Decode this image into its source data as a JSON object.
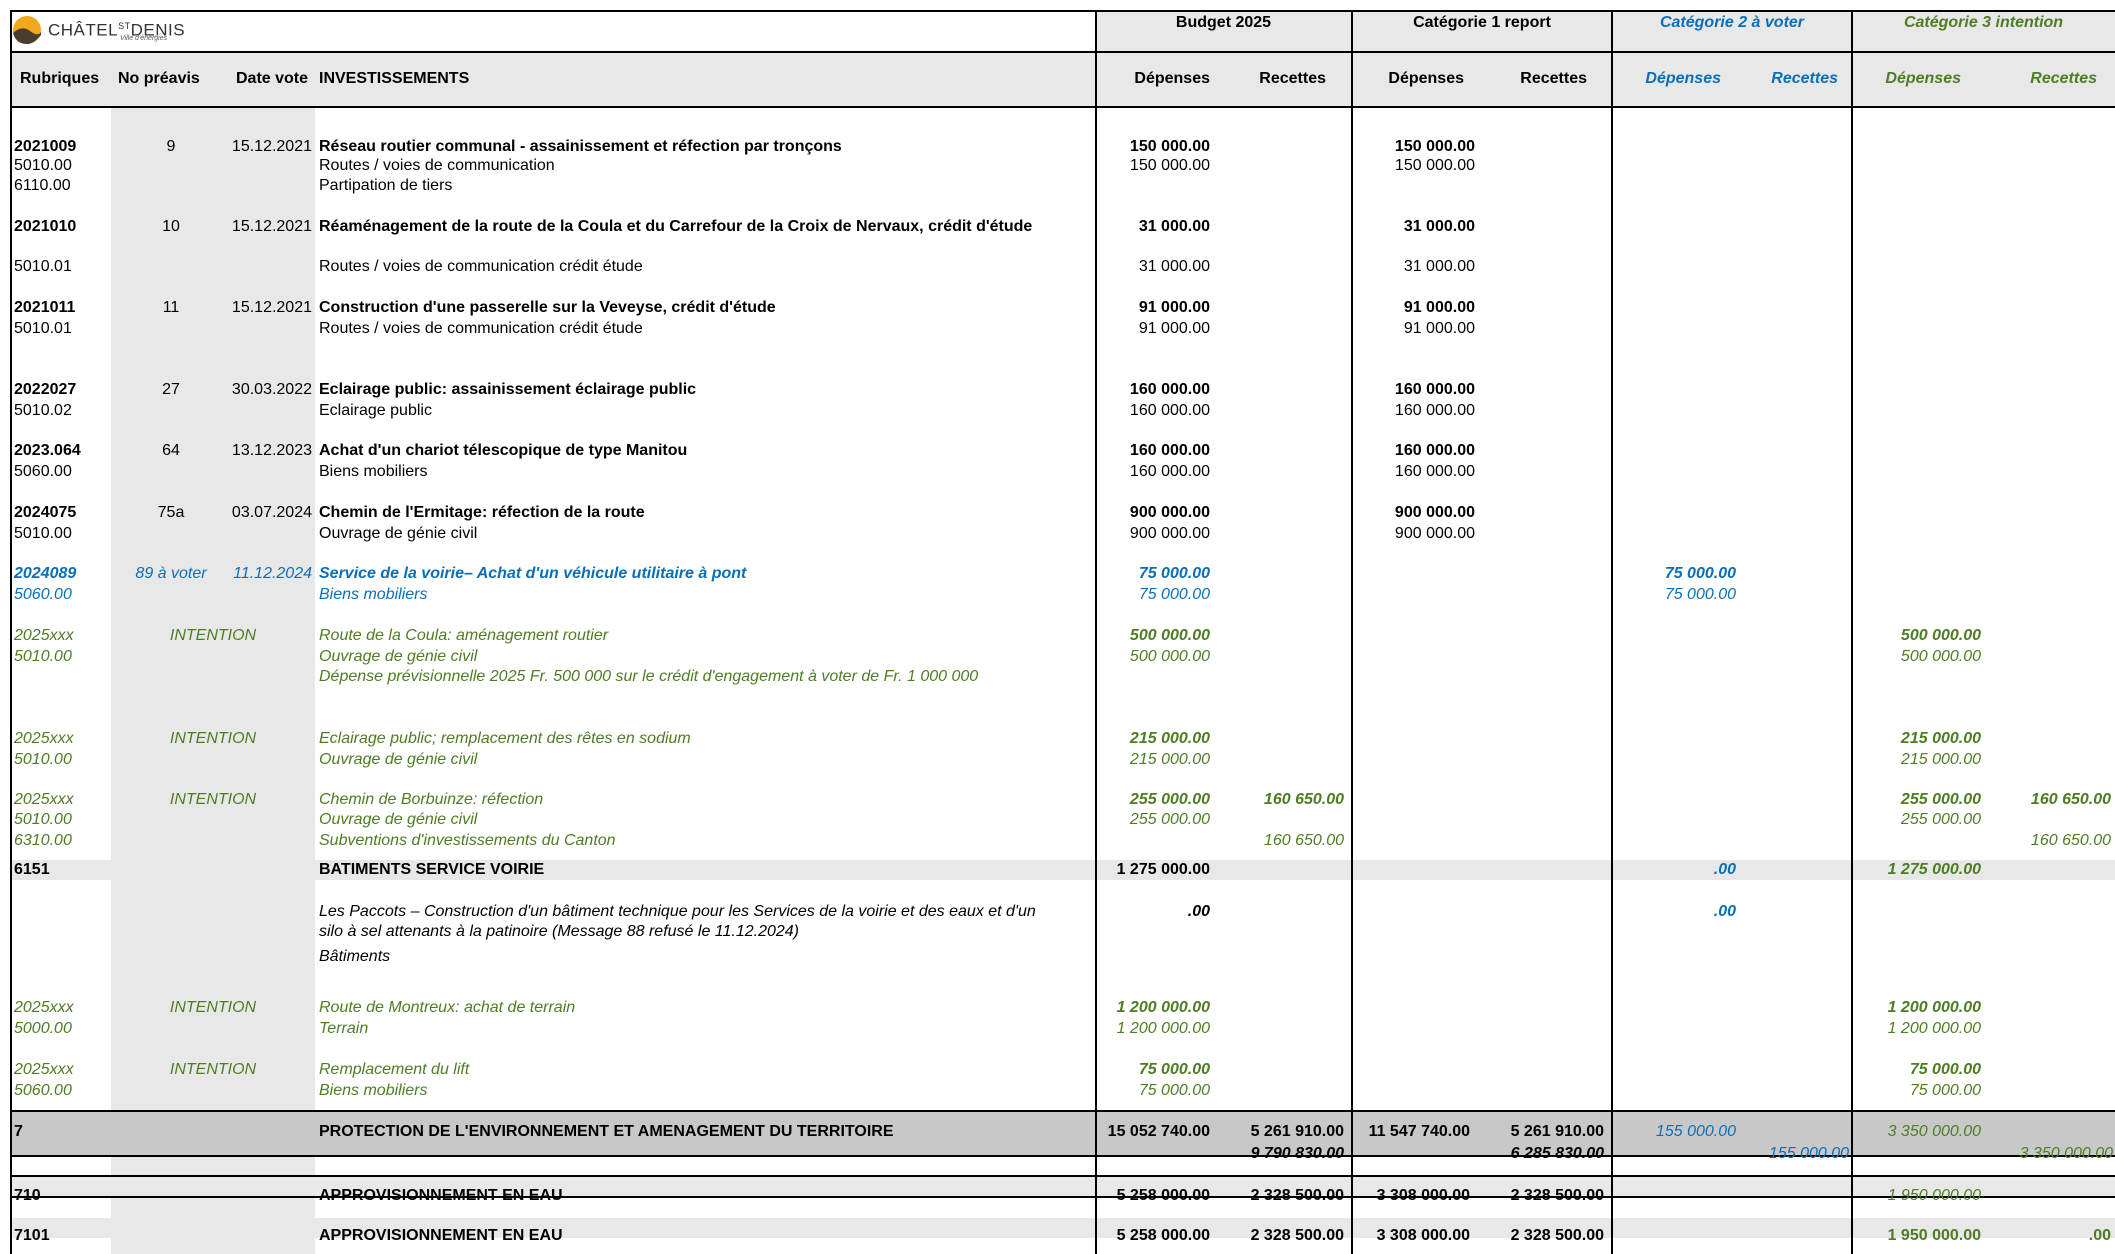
{
  "logo": {
    "name": "CHÂTEL",
    "sup": "ST",
    "name2": "DENIS",
    "tagline": "Ville d'énergies"
  },
  "header": {
    "budget": "Budget 2025",
    "cat1": "Catégorie 1 report",
    "cat2": "Catégorie 2 à voter",
    "cat3": "Catégorie 3 intention",
    "rubriques": "Rubriques",
    "no_preavis": "No préavis",
    "date_vote": "Date vote",
    "investissements": "INVESTISSEMENTS",
    "depenses": "Dépenses",
    "recettes": "Recettes"
  },
  "rows": {
    "r1": {
      "rub": "2021009",
      "no": "9",
      "date": "15.12.2021",
      "desc": "Réseau routier communal - assainissement et réfection par tronçons",
      "bd": "150 000.00",
      "c1d": "150 000.00"
    },
    "r1a": {
      "rub": "5010.00",
      "desc": "Routes / voies de communication",
      "bd": "150 000.00",
      "c1d": "150 000.00"
    },
    "r1b": {
      "rub": "6110.00",
      "desc": "Partipation de tiers"
    },
    "r2": {
      "rub": "2021010",
      "no": "10",
      "date": "15.12.2021",
      "desc": "Réaménagement de la route de la Coula et du Carrefour de la Croix de Nervaux, crédit d'étude",
      "bd": "31 000.00",
      "c1d": "31 000.00"
    },
    "r2a": {
      "rub": "5010.01",
      "desc": "Routes / voies de communication crédit étude",
      "bd": "31 000.00",
      "c1d": "31 000.00"
    },
    "r3": {
      "rub": "2021011",
      "no": "11",
      "date": "15.12.2021",
      "desc": "Construction d'une passerelle sur la Veveyse, crédit d'étude",
      "bd": "91 000.00",
      "c1d": "91 000.00"
    },
    "r3a": {
      "rub": "5010.01",
      "desc": "Routes / voies de communication crédit étude",
      "bd": "91 000.00",
      "c1d": "91 000.00"
    },
    "r4": {
      "rub": "2022027",
      "no": "27",
      "date": "30.03.2022",
      "desc": "Eclairage public: assainissement éclairage public",
      "bd": "160 000.00",
      "c1d": "160 000.00"
    },
    "r4a": {
      "rub": "5010.02",
      "desc": "Eclairage public",
      "bd": "160 000.00",
      "c1d": "160 000.00"
    },
    "r5": {
      "rub": "2023.064",
      "no": "64",
      "date": "13.12.2023",
      "desc": "Achat d'un chariot télescopique de type Manitou",
      "bd": "160 000.00",
      "c1d": "160 000.00"
    },
    "r5a": {
      "rub": "5060.00",
      "desc": "Biens mobiliers",
      "bd": "160 000.00",
      "c1d": "160 000.00"
    },
    "r6": {
      "rub": "2024075",
      "no": "75a",
      "date": "03.07.2024",
      "desc": "Chemin de l'Ermitage: réfection de la route",
      "bd": "900 000.00",
      "c1d": "900 000.00"
    },
    "r6a": {
      "rub": "5010.00",
      "desc": "Ouvrage de génie civil",
      "bd": "900 000.00",
      "c1d": "900 000.00"
    },
    "r7": {
      "rub": "2024089",
      "no": "89 à voter",
      "date": "11.12.2024",
      "desc": "Service de la voirie– Achat d'un véhicule utilitaire à pont",
      "bd": "75 000.00",
      "c2d": "75 000.00"
    },
    "r7a": {
      "rub": "5060.00",
      "desc": "Biens mobiliers",
      "bd": "75 000.00",
      "c2d": "75 000.00"
    },
    "r8": {
      "rub": "2025xxx",
      "no": "INTENTION",
      "desc": "Route de la Coula: aménagement routier",
      "bd": "500 000.00",
      "c3d": "500 000.00"
    },
    "r8a": {
      "rub": "5010.00",
      "desc": "Ouvrage de génie civil",
      "bd": "500 000.00",
      "c3d": "500 000.00"
    },
    "r8b": {
      "desc": "Dépense prévisionnelle 2025 Fr. 500 000  sur le crédit d'engagement à voter de  Fr. 1 000 000"
    },
    "r9": {
      "rub": "2025xxx",
      "no": "INTENTION",
      "desc": "Eclairage public; remplacement des rêtes en sodium",
      "bd": "215 000.00",
      "c3d": "215 000.00"
    },
    "r9a": {
      "rub": "5010.00",
      "desc": "Ouvrage de génie civil",
      "bd": "215 000.00",
      "c3d": "215 000.00"
    },
    "r10": {
      "rub": "2025xxx",
      "no": "INTENTION",
      "desc": "Chemin de Borbuinze: réfection",
      "bd": "255 000.00",
      "br": "160 650.00",
      "c3d": "255 000.00",
      "c3r": "160 650.00"
    },
    "r10a": {
      "rub": "5010.00",
      "desc": "Ouvrage de génie civil",
      "bd": "255 000.00",
      "c3d": "255 000.00"
    },
    "r10b": {
      "rub": "6310.00",
      "desc": "Subventions d'investissements du Canton",
      "br": "160 650.00",
      "c3r": "160 650.00"
    },
    "r11": {
      "rub": "6151",
      "desc": "BATIMENTS SERVICE VOIRIE",
      "bd": "1 275 000.00",
      "c2d": ".00",
      "c3d": "1 275 000.00"
    },
    "r12": {
      "desc1": "Les Paccots – Construction d'un bâtiment technique pour les Services de la voirie et des eaux et d'un",
      "desc2": "silo à sel attenants à la patinoire (Message 88 refusé le 11.12.2024)",
      "desc3": "Bâtiments",
      "bd": ".00",
      "c2d": ".00"
    },
    "r13": {
      "rub": "2025xxx",
      "no": "INTENTION",
      "desc": "Route de Montreux: achat de terrain",
      "bd": "1 200 000.00",
      "c3d": "1 200 000.00"
    },
    "r13a": {
      "rub": "5000.00",
      "desc": "Terrain",
      "bd": "1 200 000.00",
      "c3d": "1 200 000.00"
    },
    "r14": {
      "rub": "2025xxx",
      "no": "INTENTION",
      "desc": "Remplacement du lift",
      "bd": "75 000.00",
      "c3d": "75 000.00"
    },
    "r14a": {
      "rub": "5060.00",
      "desc": "Biens mobiliers",
      "bd": "75 000.00",
      "c3d": "75 000.00"
    },
    "r15": {
      "rub": "7",
      "desc": "PROTECTION DE L'ENVIRONNEMENT ET AMENAGEMENT DU TERRITOIRE",
      "bd": "15 052 740.00",
      "br": "5 261 910.00",
      "c1d": "11 547 740.00",
      "c1r": "5 261 910.00",
      "c2d": "155 000.00",
      "c3d": "3 350 000.00"
    },
    "r15a": {
      "br": "9 790 830.00",
      "c1r": "6 285 830.00",
      "c2r": "155 000.00",
      "c3r": "3 350 000.00"
    },
    "r16": {
      "rub": "710",
      "desc": "APPROVISIONNEMENT EN EAU",
      "bd": "5 258 000.00",
      "br": "2 328 500.00",
      "c1d": "3 308 000.00",
      "c1r": "2 328 500.00",
      "c3d": "1 950 000.00"
    },
    "r17": {
      "rub": "7101",
      "desc": "APPROVISIONNEMENT EN EAU",
      "bd": "5 258 000.00",
      "br": "2 328 500.00",
      "c1d": "3 308 000.00",
      "c1r": "2 328 500.00",
      "c3d": "1 950 000.00",
      "c3r": ".00"
    }
  },
  "colors": {
    "blue": "#0b6fb7",
    "green": "#4e7d24",
    "header_bg": "#e8e8e8",
    "total_bg": "#c8c8c8"
  }
}
